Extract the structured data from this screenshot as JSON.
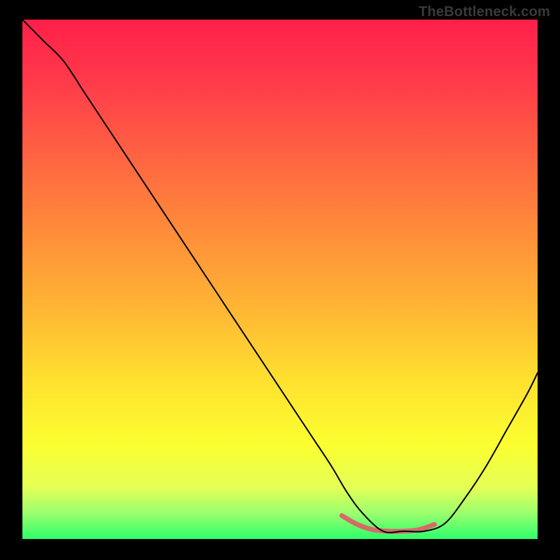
{
  "watermark": "TheBottleneck.com",
  "chart_data": {
    "type": "line",
    "title": "",
    "xlabel": "",
    "ylabel": "",
    "xlim": [
      0,
      100
    ],
    "ylim": [
      0,
      100
    ],
    "background_gradient": {
      "stops": [
        {
          "offset": 0.0,
          "color": "#ff1f4a"
        },
        {
          "offset": 0.12,
          "color": "#ff3a4a"
        },
        {
          "offset": 0.25,
          "color": "#ff6043"
        },
        {
          "offset": 0.4,
          "color": "#ff8a3a"
        },
        {
          "offset": 0.55,
          "color": "#ffb434"
        },
        {
          "offset": 0.7,
          "color": "#ffe22f"
        },
        {
          "offset": 0.82,
          "color": "#fbff30"
        },
        {
          "offset": 0.9,
          "color": "#e4ff55"
        },
        {
          "offset": 0.95,
          "color": "#9cff6e"
        },
        {
          "offset": 1.0,
          "color": "#2dff6a"
        }
      ]
    },
    "series": [
      {
        "name": "main-curve",
        "color": "#000000",
        "width": 2,
        "x": [
          0,
          4,
          8,
          12,
          16,
          20,
          24,
          28,
          32,
          36,
          40,
          44,
          48,
          52,
          56,
          60,
          63,
          66,
          70,
          74,
          78,
          82,
          86,
          90,
          94,
          98,
          100
        ],
        "y": [
          100,
          96,
          92,
          86,
          80,
          74,
          68,
          62,
          56,
          50,
          44,
          38,
          32,
          26,
          20,
          14,
          9,
          5,
          1.5,
          1.5,
          1.5,
          3,
          8,
          14,
          21,
          28,
          32
        ]
      },
      {
        "name": "highlight-segment",
        "color": "#d66a6a",
        "width": 7,
        "x": [
          62,
          65,
          68,
          71,
          74,
          77,
          80
        ],
        "y": [
          4.5,
          2.8,
          1.8,
          1.5,
          1.5,
          1.8,
          2.8
        ]
      }
    ]
  }
}
